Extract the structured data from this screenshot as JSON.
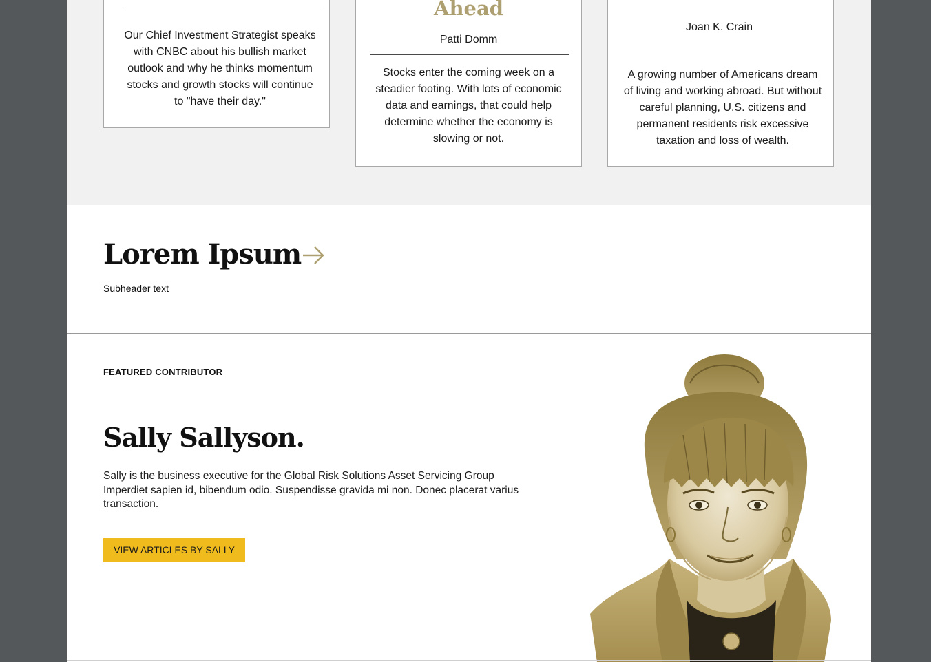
{
  "cards": [
    {
      "title": "",
      "author": "",
      "description": "Our Chief Investment Strategist speaks with CNBC about his bullish market outlook and why he thinks momentum stocks and growth stocks will continue to \"have their day.\""
    },
    {
      "title": "Ahead",
      "author": "Patti Domm",
      "description": "Stocks enter the coming week on a steadier footing. With lots of economic data and earnings, that could help determine whether the economy is slowing or not."
    },
    {
      "title": "",
      "author": "Joan K. Crain",
      "description": "A growing number of Americans dream of living and working abroad. But without careful planning, U.S. citizens and permanent residents risk excessive taxation and loss of wealth."
    }
  ],
  "section": {
    "title": "Lorem Ipsum",
    "subheader": "Subheader text",
    "arrow_icon": "arrow-right-icon"
  },
  "featured": {
    "eyebrow": "FEATURED CONTRIBUTOR",
    "name": "Sally Sallyson.",
    "bio": "Sally is the business executive for the Global Risk Solutions Asset Servicing Group Imperdiet sapien id, bibendum odio. Suspendisse gravida mi non.  Donec placerat varius transaction.",
    "cta_label": "VIEW ARTICLES BY SALLY"
  },
  "colors": {
    "accent_gold": "#ad9f70",
    "button_yellow": "#f0bb1d",
    "band_gray": "#f1f1f1",
    "frame_gray": "#55585b"
  }
}
